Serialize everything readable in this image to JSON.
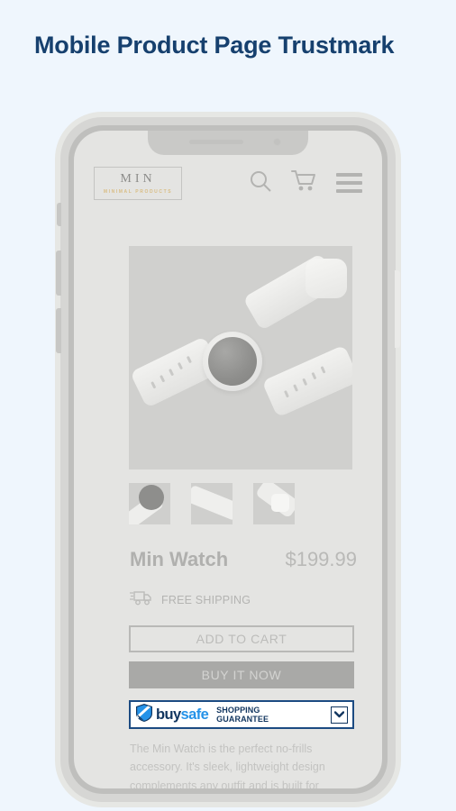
{
  "heading": "Mobile Product Page Trustmark",
  "colors": {
    "background": "#eff6fd",
    "heading": "#16406e",
    "brand_navy": "#11355f",
    "brand_blue": "#2492e8",
    "logo_gold": "#d9bd84",
    "device_body": "#d6d6d4",
    "screen": "#e4e4e2"
  },
  "store": {
    "logo": {
      "name": "MIN",
      "tagline": "MINIMAL PRODUCTS"
    },
    "icons": [
      "search-icon",
      "cart-icon",
      "hamburger-menu-icon"
    ]
  },
  "product": {
    "title": "Min Watch",
    "price": "$199.99",
    "shipping": "FREE SHIPPING",
    "shipping_icon": "delivery-truck-icon",
    "gallery": {
      "main_alt": "Min Watch white smartwatch product photo",
      "thumbnails": [
        "watch-face-thumbnail",
        "watch-strap-thumbnail",
        "watch-buckle-thumbnail"
      ]
    },
    "buttons": {
      "add_to_cart": "ADD TO CART",
      "buy_it_now": "BUY IT NOW"
    },
    "description": "The Min Watch is the perfect no-frills accessory. It's sleek, lightweight design complements any outfit and is built for"
  },
  "trustmark": {
    "brand_first": "buy",
    "brand_second": "safe",
    "line1": "SHOPPING",
    "line2": "GUARANTEE",
    "shield_icon": "buysafe-shield-icon",
    "toggle_icon": "chevron-down-icon"
  }
}
